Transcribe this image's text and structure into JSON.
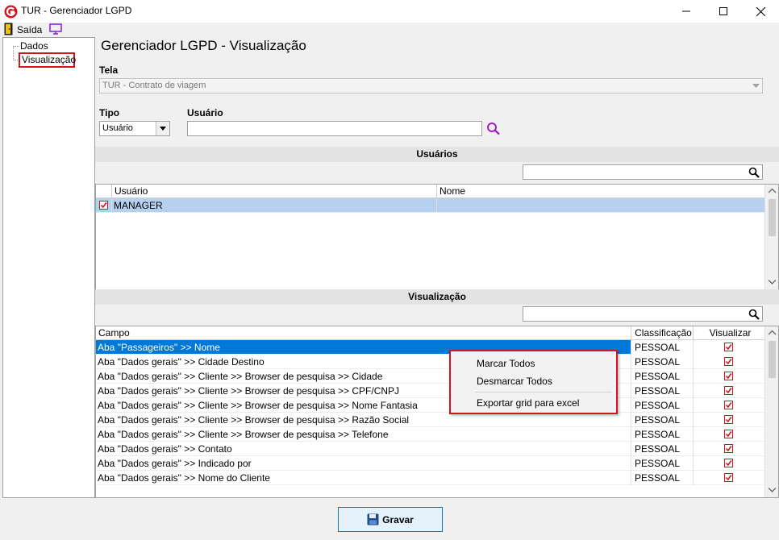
{
  "window": {
    "title": "TUR - Gerenciador LGPD",
    "controls": {
      "minimize": "—",
      "maximize": "☐",
      "close": "✕"
    }
  },
  "menu": {
    "exit_label": "Saída",
    "exit_icon": "door-exit-icon",
    "monitor_icon": "monitor-icon"
  },
  "tree": {
    "items": [
      {
        "label": "Dados",
        "selected": false
      },
      {
        "label": "Visualização",
        "selected": true
      }
    ]
  },
  "page": {
    "title": "Gerenciador LGPD - Visualização",
    "tela_label": "Tela",
    "tela_value": "TUR - Contrato de viagem",
    "tipo_label": "Tipo",
    "tipo_value": "Usuário",
    "usuario_label": "Usuário",
    "usuario_value": ""
  },
  "users_section": {
    "title": "Usuários",
    "search_value": "",
    "columns": [
      "Usuário",
      "Nome"
    ],
    "rows": [
      {
        "checked": true,
        "usuario": "MANAGER",
        "nome": ""
      }
    ]
  },
  "view_section": {
    "title": "Visualização",
    "search_value": "",
    "columns": [
      "Campo",
      "Classificação",
      "Visualizar"
    ],
    "rows": [
      {
        "campo": "Aba \"Passageiros\" >> Nome",
        "classificacao": "PESSOAL",
        "visualizar": true
      },
      {
        "campo": "Aba \"Dados gerais\" >> Cidade Destino",
        "classificacao": "PESSOAL",
        "visualizar": true
      },
      {
        "campo": "Aba \"Dados gerais\" >> Cliente >> Browser de pesquisa >> Cidade",
        "classificacao": "PESSOAL",
        "visualizar": true
      },
      {
        "campo": "Aba \"Dados gerais\" >> Cliente >> Browser de pesquisa >> CPF/CNPJ",
        "classificacao": "PESSOAL",
        "visualizar": true
      },
      {
        "campo": "Aba \"Dados gerais\" >> Cliente >> Browser de pesquisa >> Nome Fantasia",
        "classificacao": "PESSOAL",
        "visualizar": true
      },
      {
        "campo": "Aba \"Dados gerais\" >> Cliente >> Browser de pesquisa >> Razão Social",
        "classificacao": "PESSOAL",
        "visualizar": true
      },
      {
        "campo": "Aba \"Dados gerais\" >> Cliente >> Browser de pesquisa >> Telefone",
        "classificacao": "PESSOAL",
        "visualizar": true
      },
      {
        "campo": "Aba \"Dados gerais\" >> Contato",
        "classificacao": "PESSOAL",
        "visualizar": true
      },
      {
        "campo": "Aba \"Dados gerais\" >> Indicado por",
        "classificacao": "PESSOAL",
        "visualizar": true
      },
      {
        "campo": "Aba \"Dados gerais\" >> Nome do Cliente",
        "classificacao": "PESSOAL",
        "visualizar": true
      }
    ]
  },
  "context_menu": {
    "items": [
      "Marcar Todos",
      "Desmarcar Todos",
      "Exportar grid para excel"
    ]
  },
  "footer": {
    "save_label": "Gravar",
    "save_icon": "floppy-disk-icon"
  },
  "colors": {
    "selection": "#0078d7",
    "highlight_border": "#d0161c",
    "check": "#d0161c",
    "brand": "#d0161c"
  }
}
